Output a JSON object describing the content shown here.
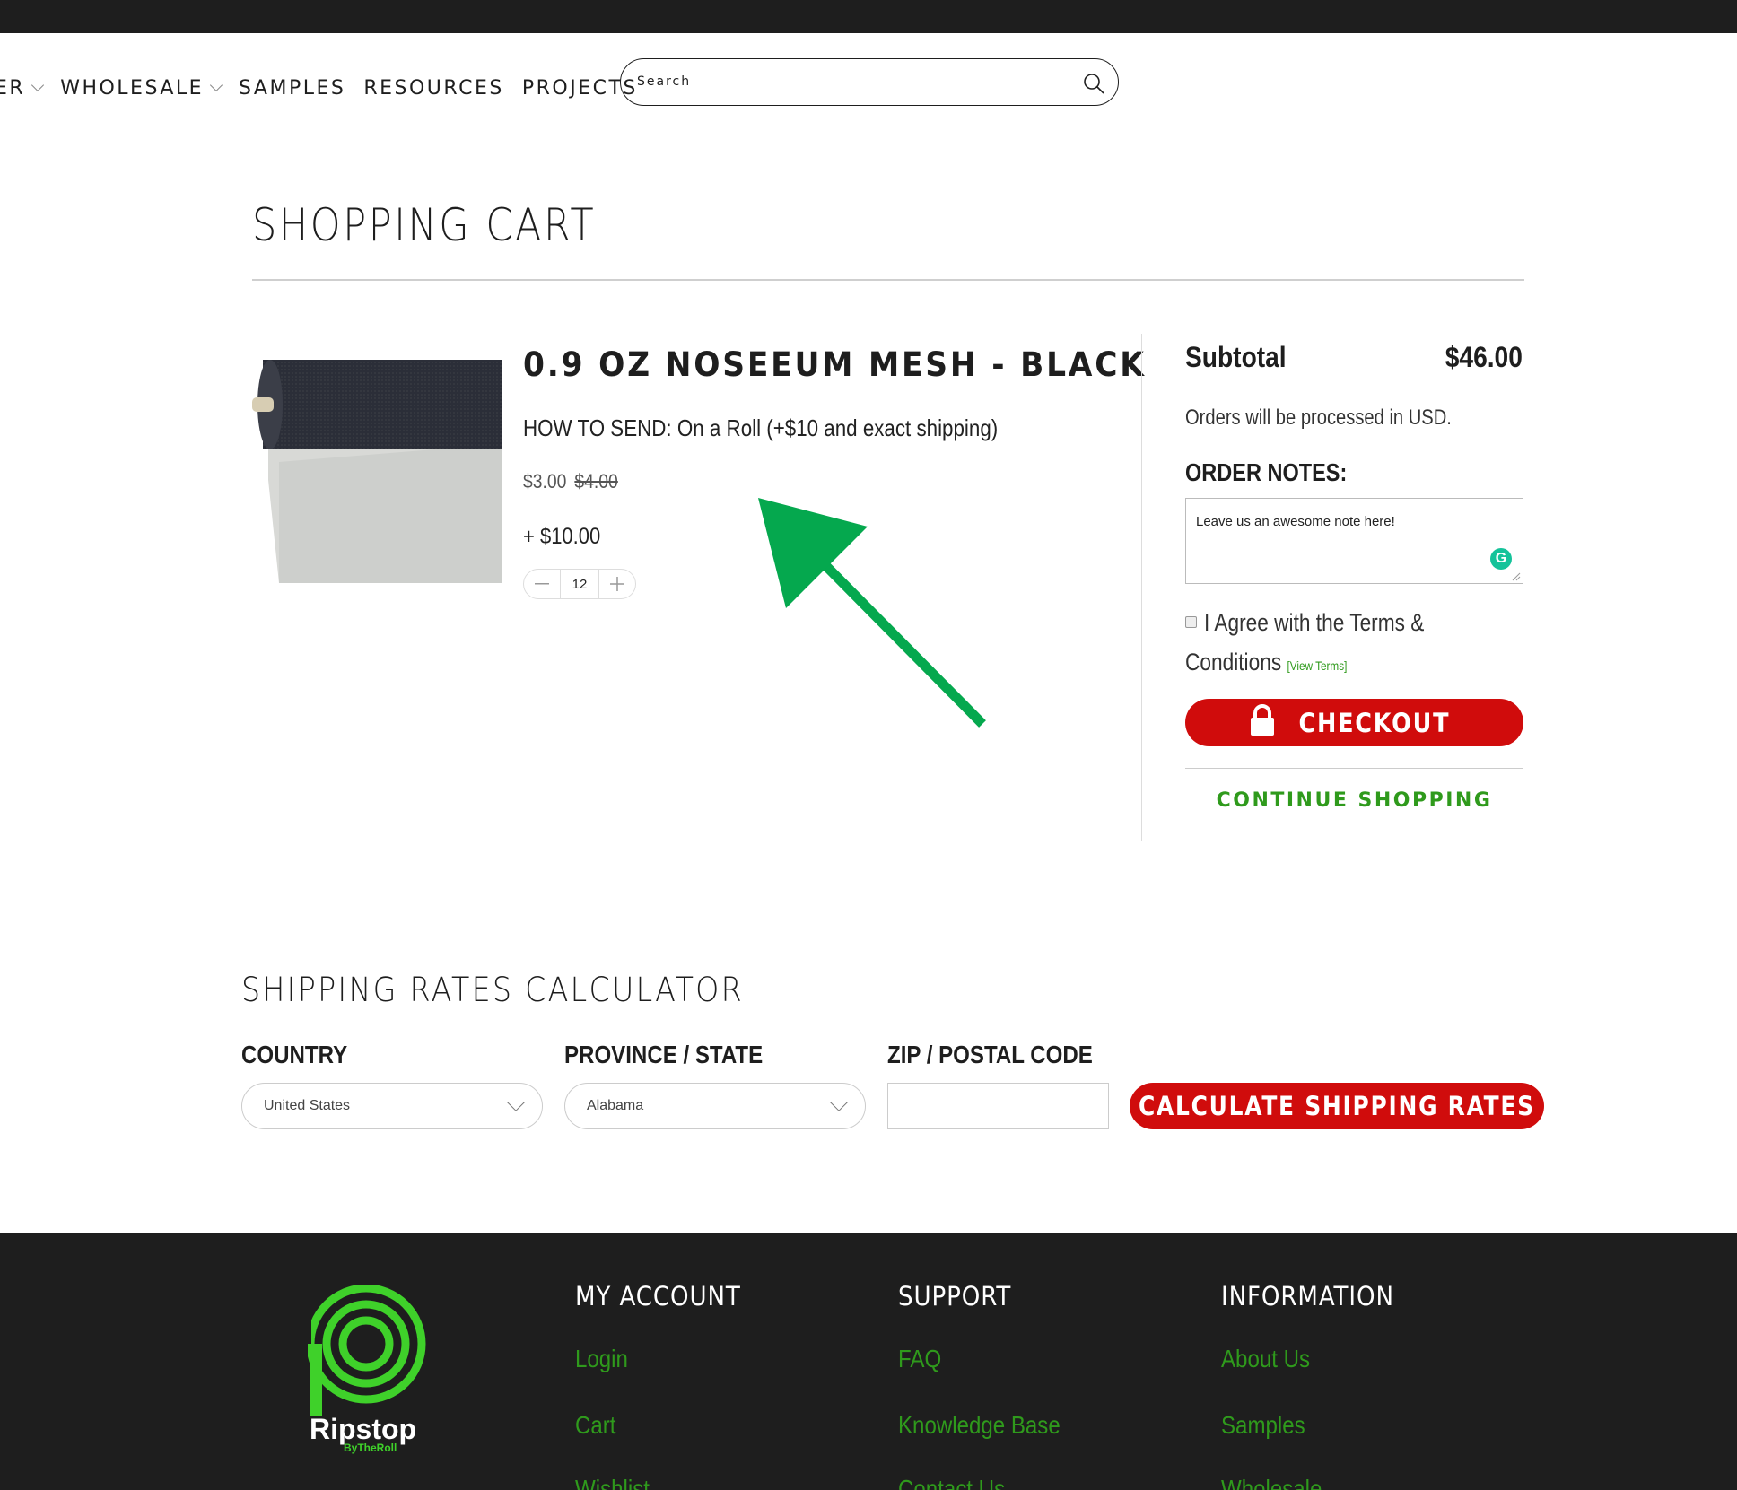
{
  "nav": {
    "items": [
      {
        "label": "ER",
        "has_dropdown": true
      },
      {
        "label": "WHOLESALE",
        "has_dropdown": true
      },
      {
        "label": "SAMPLES",
        "has_dropdown": false
      },
      {
        "label": "RESOURCES",
        "has_dropdown": false
      },
      {
        "label": "PROJECTS",
        "has_dropdown": false
      }
    ],
    "search_placeholder": "Search"
  },
  "cart": {
    "title": "SHOPPING CART",
    "item": {
      "name": "0.9 OZ NOSEEUM MESH - BLACK",
      "option": "HOW TO SEND: On a Roll (+$10 and exact shipping)",
      "price": "$3.00",
      "compare_price": "$4.00",
      "addon_price": "+ $10.00",
      "quantity": "12",
      "minus_icon": "minus-icon",
      "plus_icon": "plus-icon"
    },
    "annotation": {
      "icon": "green-arrow-icon",
      "color": "#05a84e"
    }
  },
  "summary": {
    "subtotal_label": "Subtotal",
    "subtotal_value": "$46.00",
    "currency_note": "Orders will be processed in USD.",
    "notes_label": "ORDER NOTES:",
    "notes_value": "Leave us an awesome note here!",
    "terms_line1": "I Agree with the Terms &",
    "terms_line2": "Conditions",
    "view_terms": "[View Terms]",
    "checkout_label": "CHECKOUT",
    "continue_label": "CONTINUE SHOPPING"
  },
  "shipping": {
    "title": "SHIPPING RATES CALCULATOR",
    "country_label": "COUNTRY",
    "country_value": "United States",
    "province_label": "PROVINCE / STATE",
    "province_value": "Alabama",
    "zip_label": "ZIP / POSTAL CODE",
    "zip_value": "",
    "calculate_label": "CALCULATE SHIPPING RATES"
  },
  "footer": {
    "logo_text": "Ripstop",
    "logo_subtext": "ByTheRoll",
    "columns": [
      {
        "title": "MY ACCOUNT",
        "links": [
          "Login",
          "Cart",
          "Wishlist"
        ]
      },
      {
        "title": "SUPPORT",
        "links": [
          "FAQ",
          "Knowledge Base",
          "Contact Us"
        ]
      },
      {
        "title": "INFORMATION",
        "links": [
          "About Us",
          "Samples",
          "Wholesale"
        ]
      }
    ]
  },
  "colors": {
    "accent_red": "#d00c0c",
    "accent_green": "#2f9a1c",
    "dark": "#1e1e1e"
  }
}
